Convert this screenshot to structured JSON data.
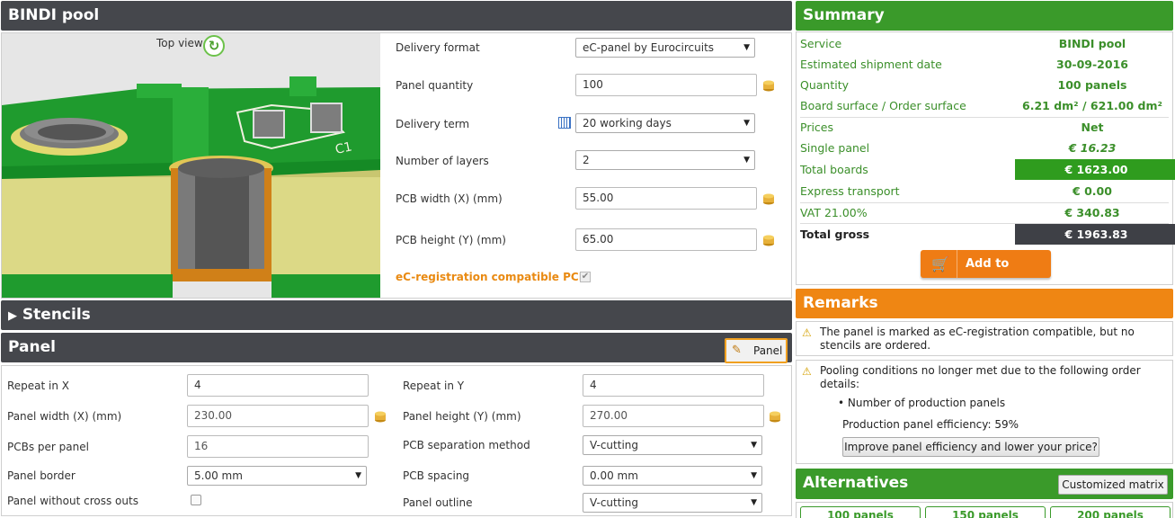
{
  "main_title": "BINDI pool",
  "preview": {
    "label": "Top view",
    "board_label": "C1"
  },
  "config": {
    "delivery_format_label": "Delivery format",
    "delivery_format_value": "eC-panel by Eurocircuits",
    "panel_quantity_label": "Panel quantity",
    "panel_quantity_value": "100",
    "delivery_term_label": "Delivery term",
    "delivery_term_value": "20 working days",
    "layers_label": "Number of layers",
    "layers_value": "2",
    "pcb_width_label": "PCB width (X) (mm)",
    "pcb_width_value": "55.00",
    "pcb_height_label": "PCB height (Y) (mm)",
    "pcb_height_value": "65.00",
    "ecreg_label": "eC-registration compatible PCB"
  },
  "stencils_title": "Stencils",
  "panel": {
    "title": "Panel",
    "button_label": "Panel",
    "repeat_x_label": "Repeat in X",
    "repeat_x_value": "4",
    "repeat_y_label": "Repeat in Y",
    "repeat_y_value": "4",
    "width_label": "Panel width (X) (mm)",
    "width_value": "230.00",
    "height_label": "Panel height (Y) (mm)",
    "height_value": "270.00",
    "pcbs_label": "PCBs per panel",
    "pcbs_value": "16",
    "separation_label": "PCB separation method",
    "separation_value": "V-cutting",
    "border_label": "Panel border",
    "border_value": "5.00 mm",
    "spacing_label": "PCB spacing",
    "spacing_value": "0.00 mm",
    "crossouts_label": "Panel without cross outs",
    "outline_label": "Panel outline",
    "outline_value": "V-cutting"
  },
  "summary": {
    "title": "Summary",
    "service_label": "Service",
    "service_value": "BINDI pool",
    "shipment_label": "Estimated shipment date",
    "shipment_value": "30-09-2016",
    "quantity_label": "Quantity",
    "quantity_value": "100 panels",
    "surface_label": "Board surface / Order surface",
    "surface_value": "6.21 dm² / 621.00 dm²",
    "prices_label": "Prices",
    "prices_value": "Net",
    "single_label": "Single panel",
    "single_value": "€ 16.23",
    "total_boards_label": "Total boards",
    "total_boards_value": "€ 1623.00",
    "express_label": "Express transport",
    "express_value": "€ 0.00",
    "vat_label": "VAT 21.00%",
    "vat_value": "€ 340.83",
    "gross_label": "Total gross",
    "gross_value": "€ 1963.83",
    "basket_label": "Add to basket"
  },
  "remarks": {
    "title": "Remarks",
    "remark1": "The panel is marked as eC-registration compatible, but no stencils are ordered.",
    "remark2": "Pooling conditions no longer met due to the following order details:",
    "bullet": "• Number of production panels",
    "efficiency": "Production panel efficiency: 59%",
    "improve_button": "Improve panel efficiency and lower your price?"
  },
  "alternatives": {
    "title": "Alternatives",
    "matrix_button": "Customized matrix",
    "tabs": [
      "100 panels",
      "150 panels",
      "200 panels"
    ]
  },
  "colors": {
    "dark_header": "#45474c",
    "green_header": "#3a9a2a",
    "orange_header": "#ef8613",
    "highlight_green": "#2f9c1e",
    "total_dark": "#3e4046",
    "ecreg_orange": "#e98a12"
  }
}
